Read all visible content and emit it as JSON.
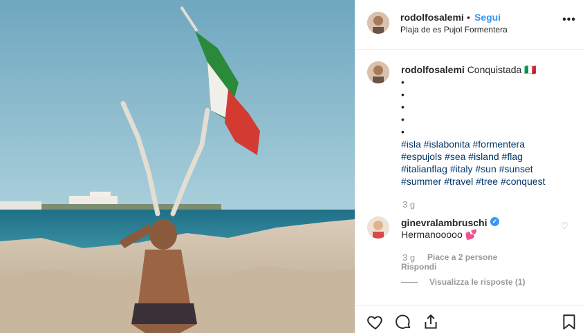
{
  "post": {
    "username": "rodolfosalemi",
    "separator": "•",
    "follow_label": "Segui",
    "location": "Plaja de es Pujol Formentera",
    "more_label": "•••"
  },
  "caption": {
    "username": "rodolfosalemi",
    "text": "Conquistada 🇮🇹",
    "bullets": [
      "•",
      "•",
      "•",
      "•",
      "•"
    ],
    "hashtag_lines": [
      "#isla #islabonita #formentera",
      "#espujols #sea #island #flag",
      "#italianflag #italy #sun #sunset",
      "#summer #travel #tree #conquest"
    ],
    "time": "3 g"
  },
  "comment": {
    "username": "ginevralambruschi",
    "verified_mark": "✓",
    "text": "Hermanooooo 💕",
    "time": "3 g",
    "likes": "Piace a 2 persone",
    "reply_label": "Rispondi",
    "view_replies": "Visualizza le risposte (1)"
  },
  "icons": {
    "like": "heart-icon",
    "comment": "comment-icon",
    "share": "share-icon",
    "save": "bookmark-icon",
    "comment_like": "heart-icon"
  },
  "colors": {
    "follow": "#3897f0",
    "hashtag": "#003569",
    "muted": "#999999",
    "border": "#efefef"
  }
}
